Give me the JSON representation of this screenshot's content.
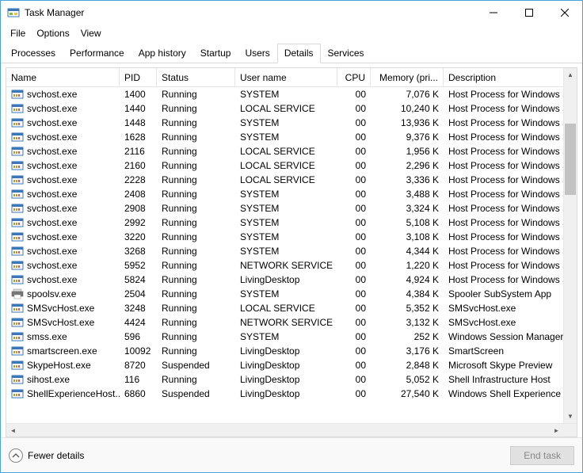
{
  "window": {
    "title": "Task Manager"
  },
  "menu": {
    "file": "File",
    "options": "Options",
    "view": "View"
  },
  "tabs": {
    "processes": "Processes",
    "performance": "Performance",
    "app_history": "App history",
    "startup": "Startup",
    "users": "Users",
    "details": "Details",
    "services": "Services",
    "active": "Details"
  },
  "columns": {
    "name": "Name",
    "pid": "PID",
    "status": "Status",
    "user": "User name",
    "cpu": "CPU",
    "memory": "Memory (pri...",
    "description": "Description"
  },
  "rows": [
    {
      "name": "svchost.exe",
      "pid": "1400",
      "status": "Running",
      "user": "SYSTEM",
      "cpu": "00",
      "mem": "7,076 K",
      "desc": "Host Process for Windows Serv",
      "icon": "exe"
    },
    {
      "name": "svchost.exe",
      "pid": "1440",
      "status": "Running",
      "user": "LOCAL SERVICE",
      "cpu": "00",
      "mem": "10,240 K",
      "desc": "Host Process for Windows Serv",
      "icon": "exe"
    },
    {
      "name": "svchost.exe",
      "pid": "1448",
      "status": "Running",
      "user": "SYSTEM",
      "cpu": "00",
      "mem": "13,936 K",
      "desc": "Host Process for Windows Serv",
      "icon": "exe"
    },
    {
      "name": "svchost.exe",
      "pid": "1628",
      "status": "Running",
      "user": "SYSTEM",
      "cpu": "00",
      "mem": "9,376 K",
      "desc": "Host Process for Windows Serv",
      "icon": "exe"
    },
    {
      "name": "svchost.exe",
      "pid": "2116",
      "status": "Running",
      "user": "LOCAL SERVICE",
      "cpu": "00",
      "mem": "1,956 K",
      "desc": "Host Process for Windows Serv",
      "icon": "exe"
    },
    {
      "name": "svchost.exe",
      "pid": "2160",
      "status": "Running",
      "user": "LOCAL SERVICE",
      "cpu": "00",
      "mem": "2,296 K",
      "desc": "Host Process for Windows Serv",
      "icon": "exe"
    },
    {
      "name": "svchost.exe",
      "pid": "2228",
      "status": "Running",
      "user": "LOCAL SERVICE",
      "cpu": "00",
      "mem": "3,336 K",
      "desc": "Host Process for Windows Serv",
      "icon": "exe"
    },
    {
      "name": "svchost.exe",
      "pid": "2408",
      "status": "Running",
      "user": "SYSTEM",
      "cpu": "00",
      "mem": "3,488 K",
      "desc": "Host Process for Windows Serv",
      "icon": "exe"
    },
    {
      "name": "svchost.exe",
      "pid": "2908",
      "status": "Running",
      "user": "SYSTEM",
      "cpu": "00",
      "mem": "3,324 K",
      "desc": "Host Process for Windows Serv",
      "icon": "exe"
    },
    {
      "name": "svchost.exe",
      "pid": "2992",
      "status": "Running",
      "user": "SYSTEM",
      "cpu": "00",
      "mem": "5,108 K",
      "desc": "Host Process for Windows Serv",
      "icon": "exe"
    },
    {
      "name": "svchost.exe",
      "pid": "3220",
      "status": "Running",
      "user": "SYSTEM",
      "cpu": "00",
      "mem": "3,108 K",
      "desc": "Host Process for Windows Serv",
      "icon": "exe"
    },
    {
      "name": "svchost.exe",
      "pid": "3268",
      "status": "Running",
      "user": "SYSTEM",
      "cpu": "00",
      "mem": "4,344 K",
      "desc": "Host Process for Windows Serv",
      "icon": "exe"
    },
    {
      "name": "svchost.exe",
      "pid": "5952",
      "status": "Running",
      "user": "NETWORK SERVICE",
      "cpu": "00",
      "mem": "1,220 K",
      "desc": "Host Process for Windows Serv",
      "icon": "exe"
    },
    {
      "name": "svchost.exe",
      "pid": "5824",
      "status": "Running",
      "user": "LivingDesktop",
      "cpu": "00",
      "mem": "4,924 K",
      "desc": "Host Process for Windows Serv",
      "icon": "exe"
    },
    {
      "name": "spoolsv.exe",
      "pid": "2504",
      "status": "Running",
      "user": "SYSTEM",
      "cpu": "00",
      "mem": "4,384 K",
      "desc": "Spooler SubSystem App",
      "icon": "printer"
    },
    {
      "name": "SMSvcHost.exe",
      "pid": "3248",
      "status": "Running",
      "user": "LOCAL SERVICE",
      "cpu": "00",
      "mem": "5,352 K",
      "desc": "SMSvcHost.exe",
      "icon": "exe"
    },
    {
      "name": "SMSvcHost.exe",
      "pid": "4424",
      "status": "Running",
      "user": "NETWORK SERVICE",
      "cpu": "00",
      "mem": "3,132 K",
      "desc": "SMSvcHost.exe",
      "icon": "exe"
    },
    {
      "name": "smss.exe",
      "pid": "596",
      "status": "Running",
      "user": "SYSTEM",
      "cpu": "00",
      "mem": "252 K",
      "desc": "Windows Session Manager",
      "icon": "exe"
    },
    {
      "name": "smartscreen.exe",
      "pid": "10092",
      "status": "Running",
      "user": "LivingDesktop",
      "cpu": "00",
      "mem": "3,176 K",
      "desc": "SmartScreen",
      "icon": "exe"
    },
    {
      "name": "SkypeHost.exe",
      "pid": "8720",
      "status": "Suspended",
      "user": "LivingDesktop",
      "cpu": "00",
      "mem": "2,848 K",
      "desc": "Microsoft Skype Preview",
      "icon": "exe"
    },
    {
      "name": "sihost.exe",
      "pid": "116",
      "status": "Running",
      "user": "LivingDesktop",
      "cpu": "00",
      "mem": "5,052 K",
      "desc": "Shell Infrastructure Host",
      "icon": "exe"
    },
    {
      "name": "ShellExperienceHost....",
      "pid": "6860",
      "status": "Suspended",
      "user": "LivingDesktop",
      "cpu": "00",
      "mem": "27,540 K",
      "desc": "Windows Shell Experience Hos",
      "icon": "exe"
    }
  ],
  "footer": {
    "fewer": "Fewer details",
    "endtask": "End task"
  }
}
